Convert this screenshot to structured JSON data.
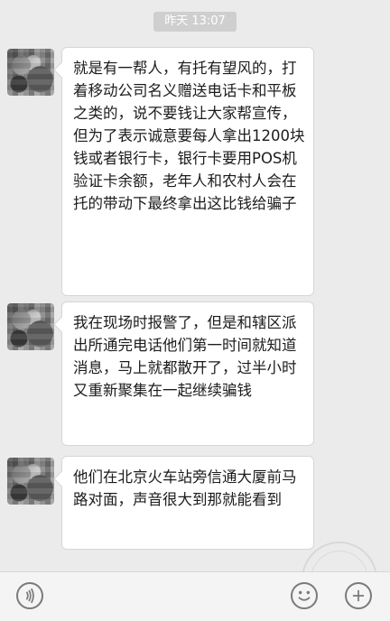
{
  "timestamp": "昨天 13:07",
  "messages": [
    {
      "text": "就是有一帮人，有托有望风的，打着移动公司名义赠送电话卡和平板之类的，说不要钱让大家帮宣传，但为了表示诚意要每人拿出1200块钱或者银行卡，银行卡要用POS机验证卡余额，老年人和农村人会在托的带动下最终拿出这比钱给骗子"
    },
    {
      "text": "我在现场时报警了，但是和辖区派出所通完电话他们第一时间就知道消息，马上就都散开了，过半小时又重新聚集在一起继续骗钱"
    },
    {
      "text": "他们在北京火车站旁信通大厦前马路对面，声音很大到那就能看到"
    }
  ],
  "input_bar": {
    "voice_icon": "voice-icon",
    "emoji_icon": "emoji-icon",
    "plus_icon": "plus-icon"
  }
}
